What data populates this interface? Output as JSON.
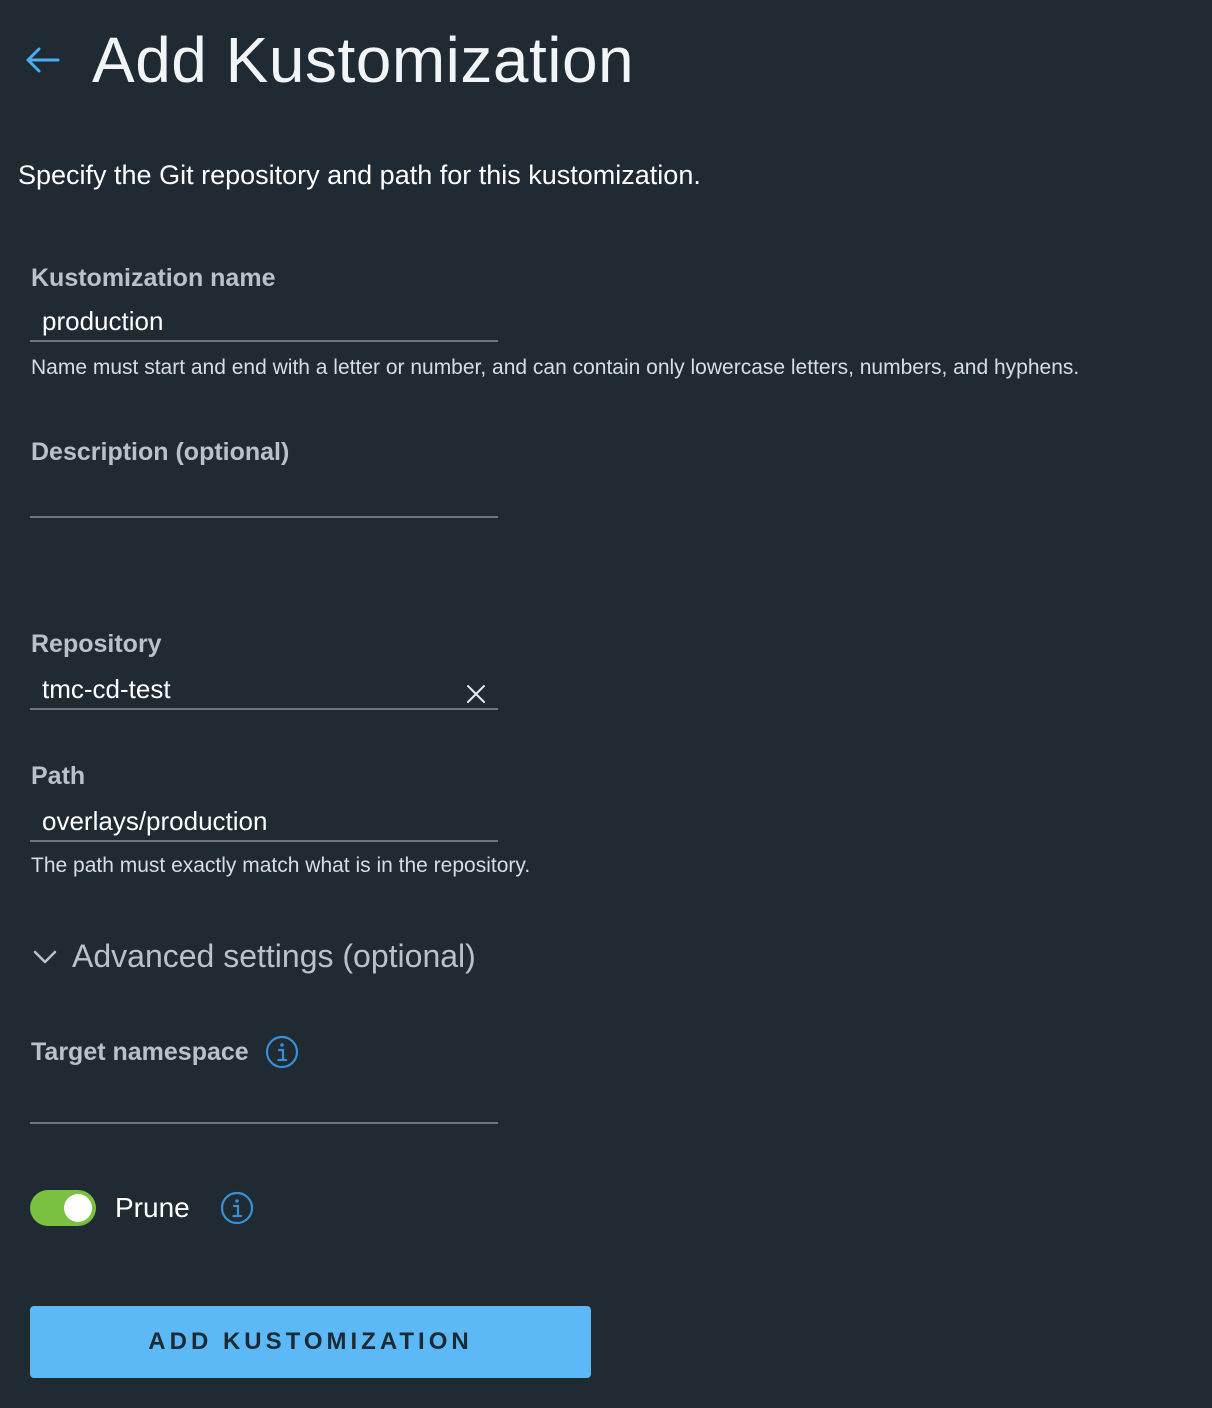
{
  "header": {
    "back_icon": "arrow-left-icon",
    "title": "Add Kustomization"
  },
  "intro": "Specify the Git repository and path for this kustomization.",
  "fields": {
    "name": {
      "label": "Kustomization name",
      "value": "production",
      "helper": "Name must start and end with a letter or number, and can contain only lowercase letters, numbers, and hyphens."
    },
    "description": {
      "label": "Description (optional)",
      "value": ""
    },
    "repository": {
      "label": "Repository",
      "value": "tmc-cd-test",
      "clear_icon": "close-icon"
    },
    "path": {
      "label": "Path",
      "value": "overlays/production",
      "helper": "The path must exactly match what is in the repository."
    }
  },
  "advanced": {
    "label": "Advanced settings (optional)",
    "expanded": true,
    "icon": "chevron-down-icon",
    "target_namespace": {
      "label": "Target namespace",
      "value": "",
      "info_icon": "info-icon"
    },
    "prune": {
      "label": "Prune",
      "enabled": true,
      "info_icon": "info-icon"
    }
  },
  "submit": {
    "label": "ADD KUSTOMIZATION"
  },
  "colors": {
    "background": "#1f2a33",
    "accent": "#5cb9f5",
    "toggle_on": "#7ac142",
    "info_icon": "#3b8fd6"
  }
}
